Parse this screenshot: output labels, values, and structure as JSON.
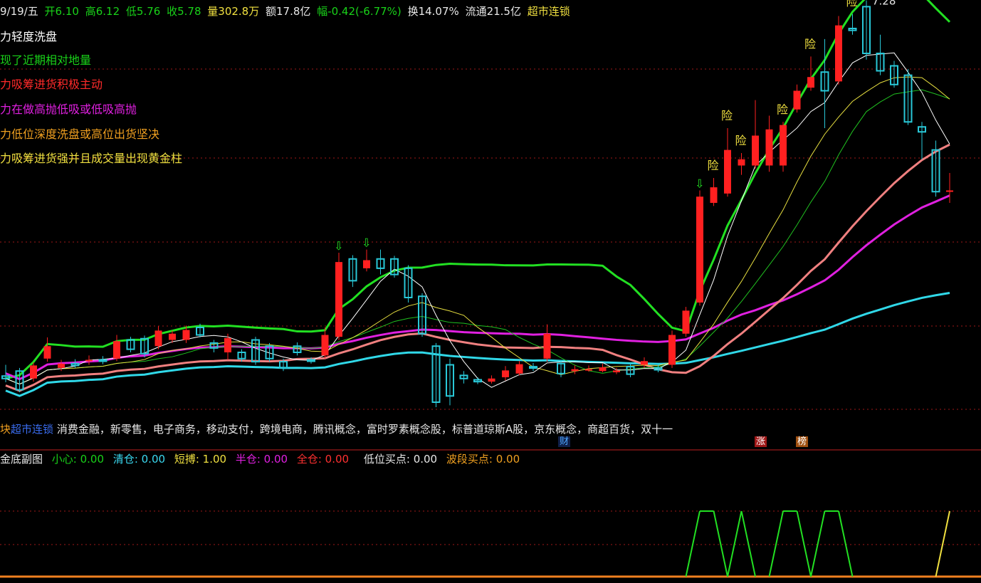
{
  "header": {
    "date": "9/19/五",
    "open": "开6.10",
    "high": "高6.12",
    "low": "低5.76",
    "close": "收5.78",
    "volume": "量302.8万",
    "amount": "额17.8亿",
    "change": "幅-0.42(-6.77%)",
    "turnover": "换14.07%",
    "float": "流通21.5亿",
    "status": "超市连锁"
  },
  "notes": [
    {
      "text": "力轻度洗盘",
      "color": "#ffffff"
    },
    {
      "text": "现了近期相对地量",
      "color": "#19d219"
    },
    {
      "text": "力吸筹进货积极主动",
      "color": "#ff2a2a"
    },
    {
      "text": "力在做高抛低吸或低吸高抛",
      "color": "#e020e0"
    },
    {
      "text": "力低位深度洗盘或高位出货坚决",
      "color": "#f0a020"
    },
    {
      "text": "力吸筹进货强并且成交量出现黄金柱",
      "color": "#f0e040"
    }
  ],
  "concepts": {
    "prefix": "块",
    "highlight": "超市连锁",
    "list": "消费金融，新零售，电子商务，移动支付，跨境电商，腾讯概念，富时罗素概念股，标普道琼斯A股，京东概念，商超百货，双十一"
  },
  "badges": {
    "cai": "财",
    "zhang": "涨",
    "bang": "榜"
  },
  "sub_indicator": {
    "name": "金底副图",
    "items": [
      {
        "label": "小心: 0.00",
        "color": "#19d219"
      },
      {
        "label": "清仓: 0.00",
        "color": "#3ad8f0"
      },
      {
        "label": "短搏: 1.00",
        "color": "#f0e040"
      },
      {
        "label": "半仓: 0.00",
        "color": "#e020e0"
      },
      {
        "label": "全仓: 0.00",
        "color": "#ff3030"
      }
    ],
    "extra": [
      {
        "label": "低位买点: 0.00",
        "color": "#e8e8e8"
      },
      {
        "label": "波段买点: 0.00",
        "color": "#f0a020"
      }
    ]
  },
  "chart_data": {
    "type": "candlestick",
    "high_label": "7.28",
    "warn_label": "险",
    "colors": {
      "up": "#ff2020",
      "down": "#29c8d8",
      "grid": "#a01818",
      "ma_white": "#ffffff",
      "ma_yellow": "#e8e040",
      "ma_green": "#20c020",
      "ma_salmon": "#f08080",
      "ma_magenta": "#e020e0",
      "ma_cyan": "#30d8e8",
      "band_green": "#22e022"
    },
    "candles": [
      [
        2.82,
        2.78,
        3.0,
        2.72
      ],
      [
        2.9,
        2.6,
        2.95,
        2.56
      ],
      [
        2.78,
        2.99,
        3.04,
        2.73
      ],
      [
        3.1,
        3.3,
        3.44,
        3.05
      ],
      [
        2.95,
        3.02,
        3.08,
        2.9
      ],
      [
        3.02,
        2.99,
        3.09,
        2.95
      ],
      [
        3.06,
        3.08,
        3.15,
        3.0
      ],
      [
        3.08,
        3.06,
        3.14,
        3.01
      ],
      [
        3.1,
        3.38,
        3.48,
        3.06
      ],
      [
        3.4,
        3.25,
        3.45,
        3.2
      ],
      [
        3.42,
        3.18,
        3.47,
        3.12
      ],
      [
        3.3,
        3.55,
        3.62,
        3.25
      ],
      [
        3.4,
        3.5,
        3.55,
        3.35
      ],
      [
        3.4,
        3.56,
        3.63,
        3.35
      ],
      [
        3.6,
        3.48,
        3.66,
        3.44
      ],
      [
        3.35,
        3.27,
        3.4,
        3.2
      ],
      [
        3.2,
        3.43,
        3.5,
        3.08
      ],
      [
        3.2,
        3.1,
        3.25,
        3.05
      ],
      [
        3.4,
        3.05,
        3.45,
        3.0
      ],
      [
        3.3,
        3.1,
        3.35,
        3.05
      ],
      [
        3.05,
        2.95,
        3.1,
        2.9
      ],
      [
        3.3,
        3.2,
        3.36,
        3.15
      ],
      [
        3.08,
        3.06,
        3.12,
        3.02
      ],
      [
        3.15,
        3.48,
        3.6,
        3.1
      ],
      [
        3.45,
        4.65,
        4.8,
        3.4
      ],
      [
        4.7,
        4.35,
        4.76,
        4.25
      ],
      [
        4.55,
        4.68,
        4.85,
        4.5
      ],
      [
        4.7,
        4.55,
        4.85,
        4.45
      ],
      [
        4.7,
        4.45,
        4.75,
        4.4
      ],
      [
        4.55,
        4.08,
        4.6,
        4.0
      ],
      [
        4.1,
        3.5,
        4.15,
        3.45
      ],
      [
        3.3,
        2.4,
        3.35,
        2.32
      ],
      [
        3.0,
        2.5,
        3.1,
        2.35
      ],
      [
        2.83,
        2.78,
        2.9,
        2.7
      ],
      [
        2.76,
        2.73,
        2.8,
        2.69
      ],
      [
        2.73,
        2.78,
        2.83,
        2.7
      ],
      [
        2.8,
        2.91,
        2.98,
        2.75
      ],
      [
        2.86,
        3.01,
        3.06,
        2.83
      ],
      [
        2.97,
        2.95,
        3.03,
        2.9
      ],
      [
        3.1,
        3.5,
        3.65,
        3.05
      ],
      [
        3.02,
        2.86,
        3.08,
        2.8
      ],
      [
        2.9,
        2.93,
        2.99,
        2.85
      ],
      [
        2.91,
        2.93,
        2.99,
        2.89
      ],
      [
        2.9,
        2.96,
        3.02,
        2.88
      ],
      [
        2.88,
        2.91,
        2.95,
        2.85
      ],
      [
        2.97,
        2.85,
        3.03,
        2.8
      ],
      [
        3.0,
        3.06,
        3.12,
        2.95
      ],
      [
        2.95,
        2.92,
        3.0,
        2.88
      ],
      [
        3.0,
        3.48,
        3.55,
        2.95
      ],
      [
        3.5,
        3.87,
        3.93,
        3.45
      ],
      [
        4.0,
        5.7,
        5.8,
        3.95
      ],
      [
        5.6,
        5.85,
        6.0,
        5.55
      ],
      [
        5.75,
        6.45,
        6.8,
        5.7
      ],
      [
        6.2,
        6.3,
        6.4,
        6.05
      ],
      [
        6.2,
        6.68,
        7.25,
        6.15
      ],
      [
        6.2,
        6.78,
        7.0,
        6.1
      ],
      [
        6.2,
        6.85,
        6.9,
        6.1
      ],
      [
        7.1,
        7.4,
        7.5,
        7.05
      ],
      [
        7.45,
        7.62,
        7.95,
        7.4
      ],
      [
        7.7,
        7.4,
        8.23,
        6.8
      ],
      [
        7.55,
        8.45,
        8.6,
        7.5
      ],
      [
        8.4,
        8.37,
        8.63,
        8.3
      ],
      [
        8.75,
        8.0,
        8.85,
        7.9
      ],
      [
        8.0,
        7.72,
        8.3,
        7.65
      ],
      [
        7.8,
        7.5,
        7.88,
        7.45
      ],
      [
        7.65,
        6.9,
        7.75,
        6.85
      ],
      [
        6.82,
        6.74,
        6.9,
        6.3
      ],
      [
        6.45,
        5.78,
        6.6,
        5.7
      ],
      [
        5.8,
        5.8,
        6.08,
        5.6
      ]
    ],
    "warn_indices": [
      51,
      52,
      53,
      56,
      58,
      61
    ],
    "arrow_indices": [
      24,
      26,
      50
    ],
    "sub_series": [
      0,
      0,
      0,
      0,
      0,
      0,
      0,
      0,
      0,
      0,
      0,
      0,
      0,
      0,
      0,
      0,
      0,
      0,
      0,
      0,
      0,
      0,
      0,
      0,
      0,
      0,
      0,
      0,
      0,
      0,
      0,
      0,
      0,
      0,
      0,
      0,
      0,
      0,
      0,
      0,
      0,
      0,
      0,
      0,
      0,
      0,
      0,
      0,
      0,
      0,
      1,
      1,
      0,
      1,
      0,
      0,
      1,
      1,
      0,
      1,
      1,
      0,
      0,
      0,
      0,
      0,
      0,
      0,
      1
    ]
  }
}
